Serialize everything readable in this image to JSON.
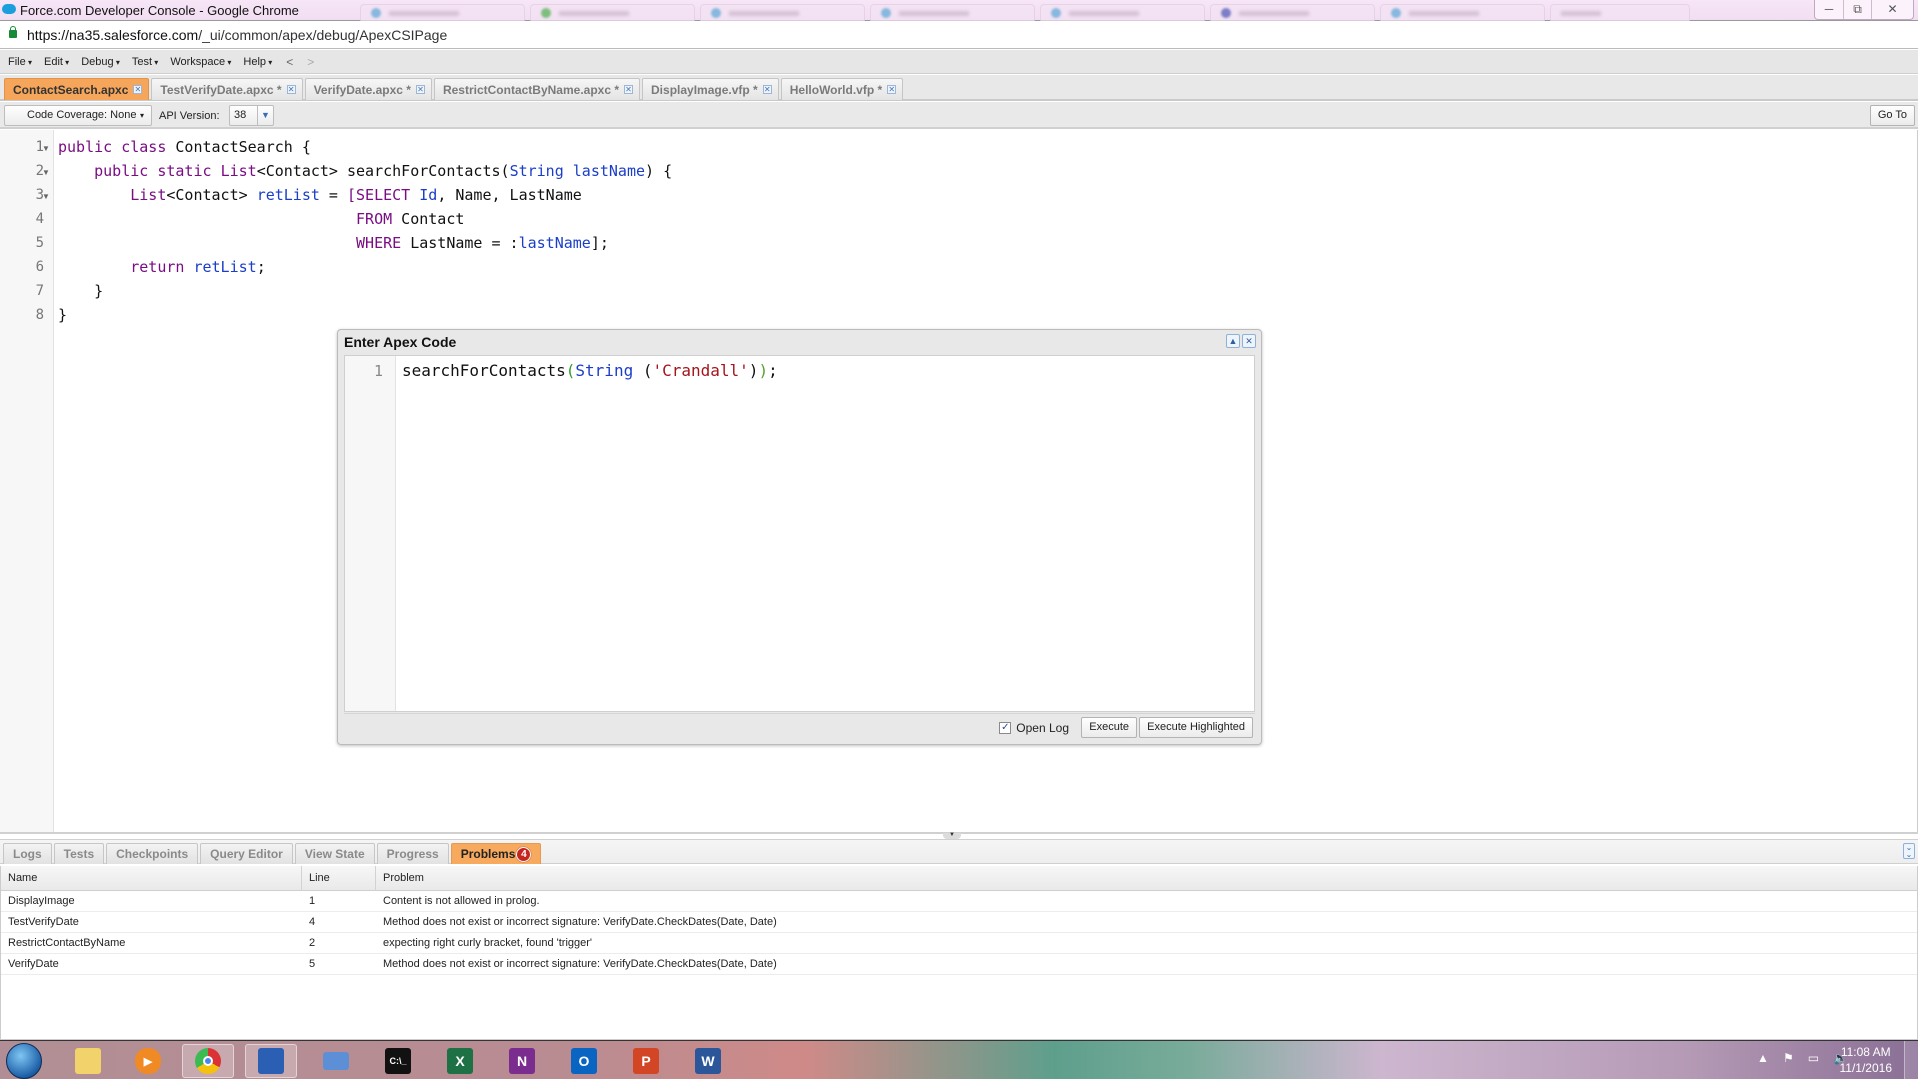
{
  "browser": {
    "window_title": "Force.com Developer Console - Google Chrome",
    "url_host": "https://na35.salesforce.com",
    "url_path": "/_ui/common/apex/debug/ApexCSIPage",
    "window_buttons": {
      "minimize": "─",
      "restore": "⧉",
      "close": "✕"
    }
  },
  "menu": {
    "items": [
      "File",
      "Edit",
      "Debug",
      "Test",
      "Workspace",
      "Help"
    ],
    "back": "<",
    "forward": ">"
  },
  "file_tabs": [
    {
      "label": "ContactSearch.apxc",
      "active": true
    },
    {
      "label": "TestVerifyDate.apxc *",
      "active": false
    },
    {
      "label": "VerifyDate.apxc *",
      "active": false
    },
    {
      "label": "RestrictContactByName.apxc *",
      "active": false
    },
    {
      "label": "DisplayImage.vfp *",
      "active": false
    },
    {
      "label": "HelloWorld.vfp *",
      "active": false
    }
  ],
  "toolbar": {
    "code_coverage": "Code Coverage: None",
    "api_version_label": "API Version:",
    "api_version": "38",
    "goto_label": "Go To"
  },
  "editor": {
    "line_numbers": [
      "1",
      "2",
      "3",
      "4",
      "5",
      "6",
      "7",
      "8"
    ],
    "lines": [
      "public class ContactSearch {",
      "    public static List<Contact> searchForContacts(String lastName) {",
      "        List<Contact> retList = [SELECT Id, Name, LastName",
      "                                 FROM Contact",
      "                                 WHERE LastName = :lastName];",
      "        return retList;",
      "    }",
      "}"
    ]
  },
  "dialog": {
    "title": "Enter Apex Code",
    "line_number": "1",
    "code": "searchForContacts(String ('Crandall'));",
    "open_log_label": "Open Log",
    "open_log_checked": true,
    "execute_label": "Execute",
    "execute_highlighted_label": "Execute Highlighted"
  },
  "bottom_panel": {
    "tabs": [
      {
        "label": "Logs",
        "active": false
      },
      {
        "label": "Tests",
        "active": false
      },
      {
        "label": "Checkpoints",
        "active": false
      },
      {
        "label": "Query Editor",
        "active": false
      },
      {
        "label": "View State",
        "active": false
      },
      {
        "label": "Progress",
        "active": false
      },
      {
        "label": "Problems",
        "active": true,
        "badge": "4"
      }
    ],
    "columns": [
      "Name",
      "Line",
      "Problem"
    ],
    "rows": [
      {
        "name": "DisplayImage",
        "line": "1",
        "problem": "Content is not allowed in prolog."
      },
      {
        "name": "TestVerifyDate",
        "line": "4",
        "problem": "Method does not exist or incorrect signature: VerifyDate.CheckDates(Date, Date)"
      },
      {
        "name": "RestrictContactByName",
        "line": "2",
        "problem": "expecting right curly bracket, found 'trigger'"
      },
      {
        "name": "VerifyDate",
        "line": "5",
        "problem": "Method does not exist or incorrect signature: VerifyDate.CheckDates(Date, Date)"
      }
    ]
  },
  "taskbar": {
    "apps": [
      "start",
      "file-explorer",
      "media-player",
      "chrome",
      "remote-desktop",
      "window-app",
      "command-prompt",
      "excel",
      "onenote",
      "outlook",
      "powerpoint",
      "word"
    ],
    "time": "11:08 AM",
    "date": "11/1/2016"
  },
  "colors": {
    "active_tab": "#f5a65b",
    "keyword": "#7a0d84",
    "identifier": "#1a3ec9",
    "string": "#a4141b",
    "badge": "#c6241f"
  }
}
